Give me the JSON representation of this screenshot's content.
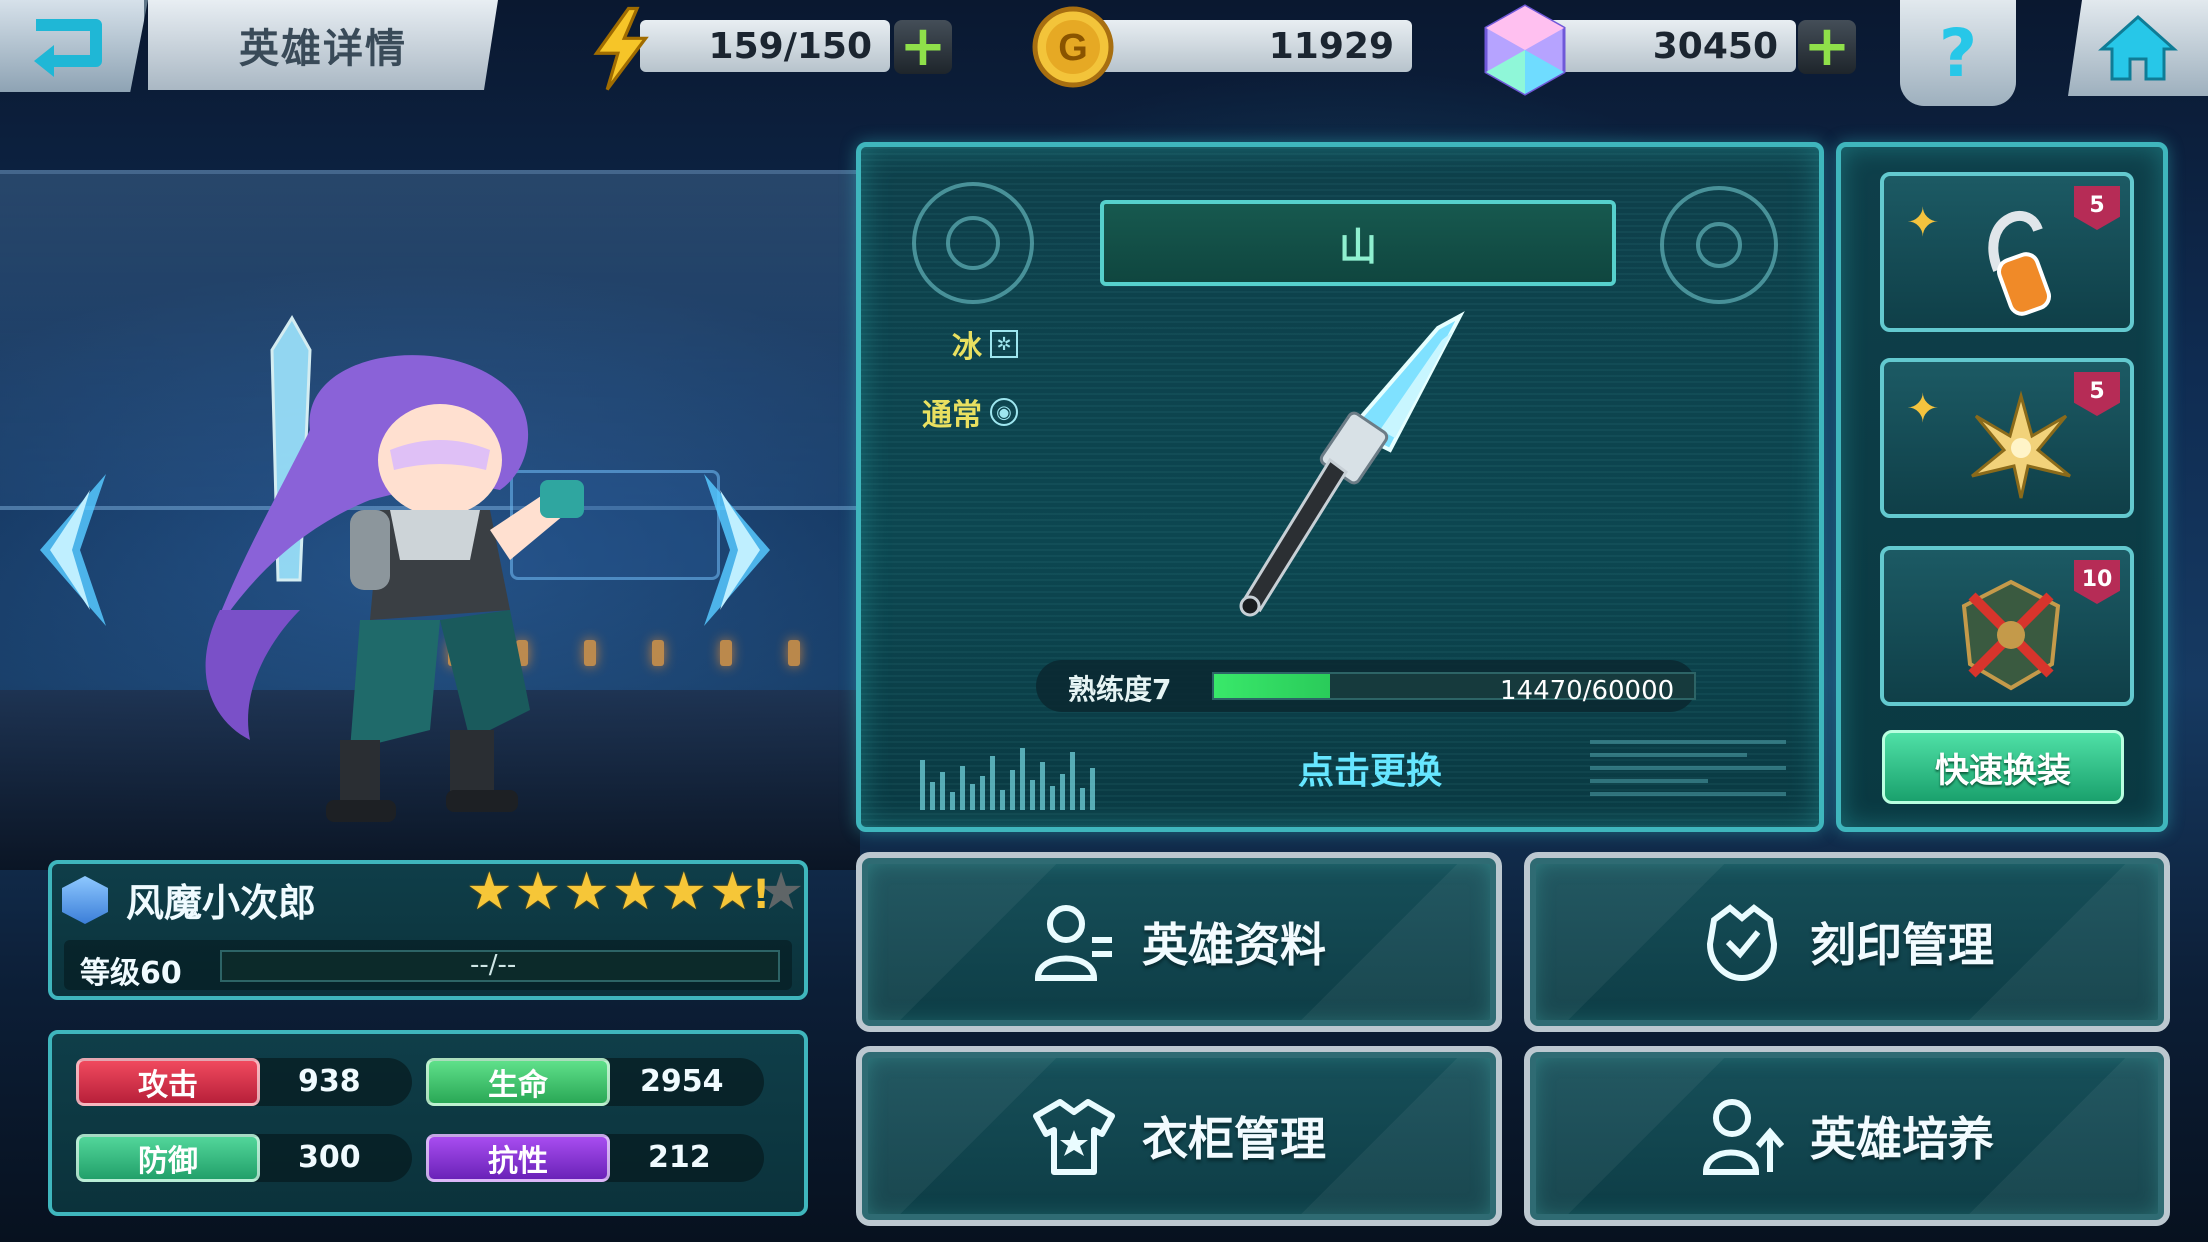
{
  "header": {
    "title": "英雄详情",
    "stamina": "159/150",
    "gold": "11929",
    "gems": "30450"
  },
  "weapon": {
    "name": "山",
    "element": "冰",
    "attack_type": "通常",
    "mastery_label": "熟练度7",
    "mastery_value": "14470/60000",
    "mastery_progress": 0.2412,
    "change_label": "点击更换"
  },
  "equipment": {
    "slots": [
      {
        "icon": "earpiece-icon",
        "level": "5"
      },
      {
        "icon": "golden-wings-icon",
        "level": "5"
      },
      {
        "icon": "crossed-shield-icon",
        "level": "10"
      }
    ],
    "quick_swap_label": "快速换装"
  },
  "hero": {
    "name": "风魔小次郎",
    "stars": 6,
    "max_stars": 7,
    "level_label": "等级60",
    "exp_text": "--/--",
    "stats": {
      "attack_label": "攻击",
      "attack": "938",
      "hp_label": "生命",
      "hp": "2954",
      "defense_label": "防御",
      "defense": "300",
      "resist_label": "抗性",
      "resist": "212"
    }
  },
  "menu": {
    "profile": "英雄资料",
    "imprint": "刻印管理",
    "wardrobe": "衣柜管理",
    "training": "英雄培养"
  },
  "colors": {
    "panel_border": "#3fb6bd",
    "attack": "#d8344c",
    "hp": "#3fcf72",
    "defense": "#35c487",
    "resist": "#8a35d8",
    "accent": "#66e6ff"
  }
}
